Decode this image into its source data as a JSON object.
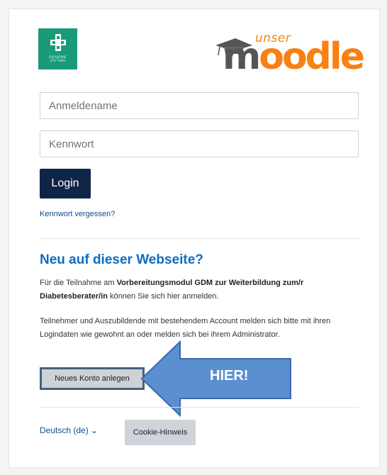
{
  "brand": {
    "logo_lines": [
      "DIEAKONIE",
      "STIFTUNG"
    ]
  },
  "moodle_logo": {
    "prefix": "unser",
    "word_first": "m",
    "word_rest": "oodle"
  },
  "login": {
    "username_placeholder": "Anmeldename",
    "password_placeholder": "Kennwort",
    "login_label": "Login",
    "forgot_label": "Kennwort vergessen?"
  },
  "signup": {
    "heading": "Neu auf dieser Webseite?",
    "para1_pre": "Für die Teilnahme am ",
    "para1_bold": "Vorbereitungsmodul GDM zur Weiterbildung zum/r Diabetesberater/in",
    "para1_post": " können Sie sich hier anmelden.",
    "para2": "Teilnehmer und Auszubildende mit bestehendem Account melden sich bitte mit ihren Logindaten wie gewohnt an oder melden sich bei ihrem Administrator.",
    "create_label": "Neues Konto anlegen"
  },
  "annotation": {
    "arrow_text": "HIER!",
    "arrow_color": "#5a8fd0"
  },
  "footer": {
    "language_label": "Deutsch (de)",
    "language_chevron": "⌄",
    "cookie_label": "Cookie-Hinweis"
  },
  "colors": {
    "primary_dark": "#0f2546",
    "heading_blue": "#0f6cbf",
    "moodle_orange": "#f98012",
    "brand_green": "#1a9a79"
  }
}
